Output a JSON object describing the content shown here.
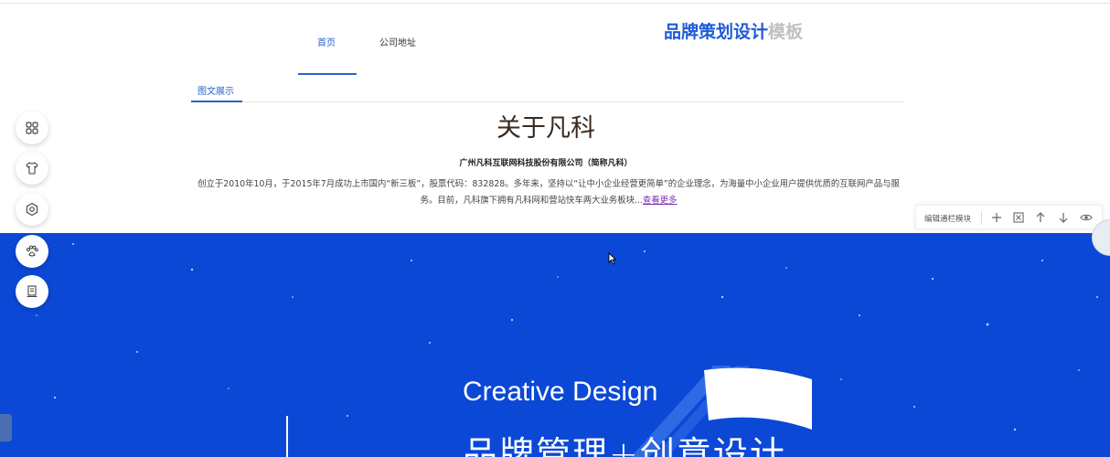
{
  "nav": {
    "items": [
      {
        "label": "首页",
        "active": true
      },
      {
        "label": "公司地址",
        "active": false
      }
    ]
  },
  "brand": {
    "part1": "品牌策划设计",
    "part2": "模板"
  },
  "subtab": {
    "label": "图文展示"
  },
  "about": {
    "title": "关于凡科",
    "company": "广州凡科互联网科技股份有限公司（简称凡科）",
    "desc": "创立于2010年10月，于2015年7月成功上市国内“新三板”，股票代码：832828。多年来，坚持以“让中小企业经营更简单”的企业理念，为海量中小企业用户提供优质的互联网产品与服务。目前，凡科旗下拥有凡科网和营站快车两大业务板块...",
    "more": "查看更多"
  },
  "toolbar": {
    "label": "编辑通栏模块",
    "icons": [
      "plus-icon",
      "copy-icon",
      "arrow-up-icon",
      "arrow-down-icon",
      "eye-icon"
    ]
  },
  "sidebar": {
    "icons": [
      "grid-icon",
      "shirt-icon",
      "settings-icon",
      "paw-icon",
      "book-icon"
    ]
  },
  "hero": {
    "en": "Creative Design",
    "cn": "品牌管理+创意设计",
    "bg": "#0b48d6"
  },
  "colors": {
    "accent": "#2a63c9",
    "brand": "#1e5bd8"
  }
}
